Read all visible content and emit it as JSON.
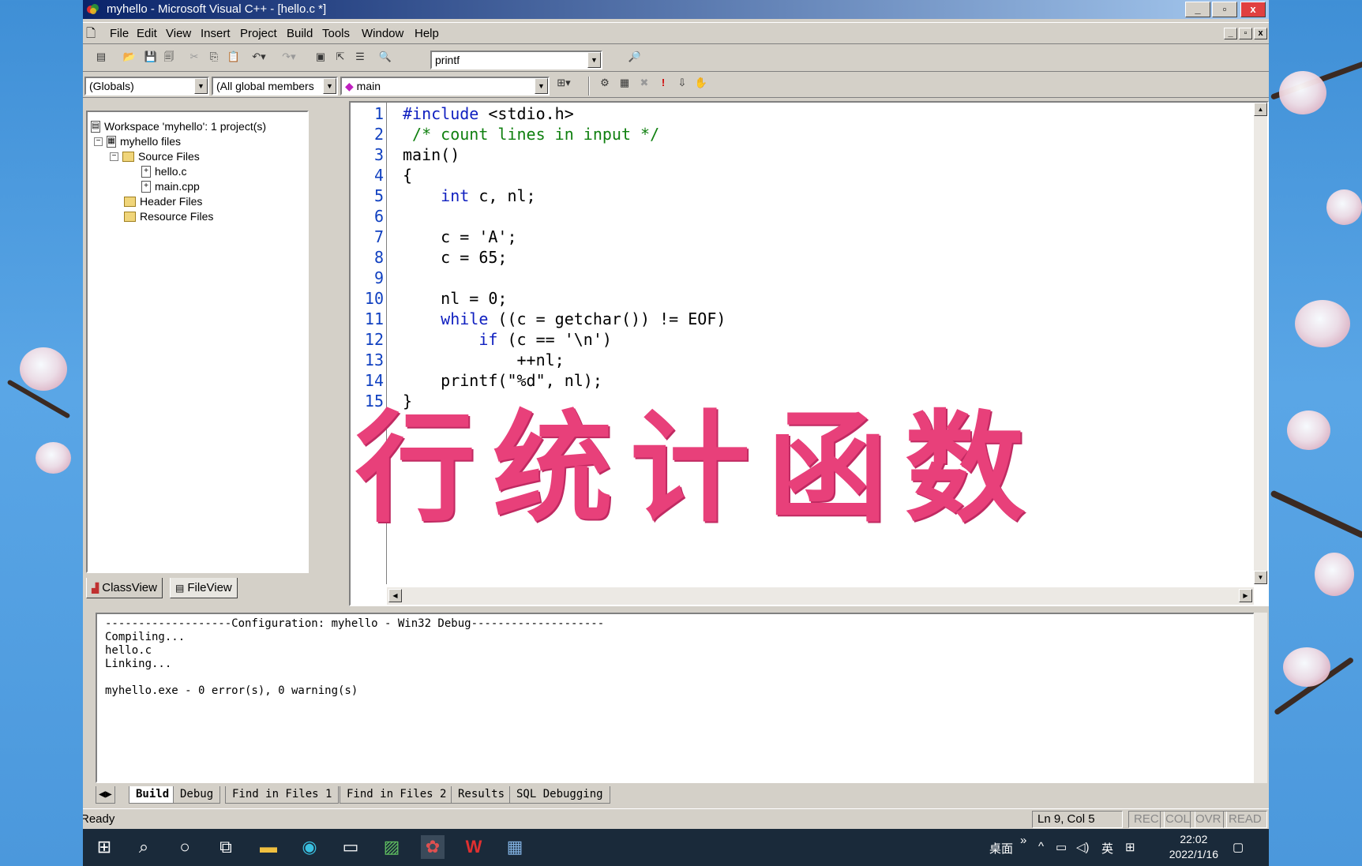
{
  "window": {
    "title": "myhello - Microsoft Visual C++ - [hello.c *]",
    "minimize": "_",
    "restore": "▫",
    "close": "x"
  },
  "menu": {
    "items": [
      "File",
      "Edit",
      "View",
      "Insert",
      "Project",
      "Build",
      "Tools",
      "Window",
      "Help"
    ],
    "mdi": [
      "_",
      "▫",
      "x"
    ]
  },
  "toolbar": {
    "find_combo": "printf"
  },
  "wizardbar": {
    "scope": "(Globals)",
    "members": "(All global members",
    "function": "main"
  },
  "workspace": {
    "root": "Workspace 'myhello': 1 project(s)",
    "project": "myhello files",
    "source_folder": "Source Files",
    "files": [
      "hello.c",
      "main.cpp"
    ],
    "header_folder": "Header Files",
    "resource_folder": "Resource Files",
    "tabs": [
      "ClassView",
      "FileView"
    ]
  },
  "editor": {
    "line_numbers": [
      "1",
      "2",
      "3",
      "4",
      "5",
      "6",
      "7",
      "8",
      "9",
      "10",
      "11",
      "12",
      "13",
      "14",
      "15"
    ],
    "lines": [
      {
        "pre": "#include ",
        "kw": "",
        "post": "<stdio.h>",
        "cm": ""
      },
      {
        "pre": "",
        "kw": "",
        "post": "",
        "cm": " /* count lines in input */"
      },
      {
        "pre": "main()",
        "kw": "",
        "post": "",
        "cm": ""
      },
      {
        "pre": "{",
        "kw": "",
        "post": "",
        "cm": ""
      },
      {
        "pre": "    ",
        "kw": "int",
        "post": " c, nl;",
        "cm": ""
      },
      {
        "pre": "",
        "kw": "",
        "post": "",
        "cm": ""
      },
      {
        "pre": "    c = 'A';",
        "kw": "",
        "post": "",
        "cm": ""
      },
      {
        "pre": "    c = 65;",
        "kw": "",
        "post": "",
        "cm": ""
      },
      {
        "pre": "",
        "kw": "",
        "post": "",
        "cm": ""
      },
      {
        "pre": "    nl = 0;",
        "kw": "",
        "post": "",
        "cm": ""
      },
      {
        "pre": "    ",
        "kw": "while",
        "post": " ((c = getchar()) != EOF)",
        "cm": ""
      },
      {
        "pre": "        ",
        "kw": "if",
        "post": " (c == '\\n')",
        "cm": ""
      },
      {
        "pre": "            ++nl;",
        "kw": "",
        "post": "",
        "cm": ""
      },
      {
        "pre": "    printf(\"%d\", nl);",
        "kw": "",
        "post": "",
        "cm": ""
      },
      {
        "pre": "}",
        "kw": "",
        "post": "",
        "cm": ""
      }
    ]
  },
  "output": {
    "lines": [
      "-------------------Configuration: myhello - Win32 Debug--------------------",
      "Compiling...",
      "hello.c",
      "Linking...",
      "",
      "myhello.exe - 0 error(s), 0 warning(s)"
    ],
    "tabs": [
      "Build",
      "Debug",
      "Find in Files 1",
      "Find in Files 2",
      "Results",
      "SQL Debugging"
    ]
  },
  "status": {
    "ready": "Ready",
    "position": "Ln 9, Col 5",
    "indicators": [
      "REC",
      "COL",
      "OVR",
      "READ"
    ]
  },
  "taskbar": {
    "ime_desktop": "桌面",
    "ime_lang": "英",
    "time": "22:02",
    "date": "2022/1/16"
  },
  "overlay": {
    "text": "行统计函数"
  },
  "colors": {
    "title_start": "#0a246a",
    "overlay": "#e8407a",
    "keyword": "#1020c0",
    "comment": "#108010"
  }
}
